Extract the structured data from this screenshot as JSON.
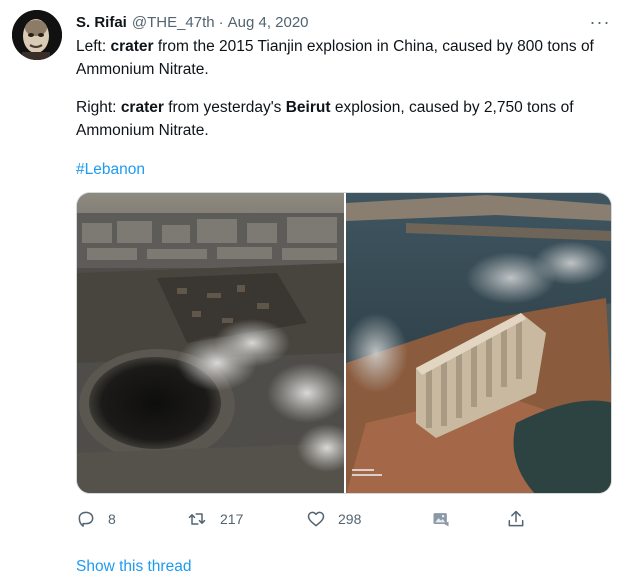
{
  "tweet": {
    "author_name": "S. Rifai",
    "handle": "@THE_47th",
    "separator": "·",
    "date": "Aug 4, 2020",
    "more_label": "···",
    "p1": {
      "prefix": "Left: ",
      "bold1": "crater",
      "middle": " from the 2015 Tianjin explosion in China, caused by 800 tons of Ammonium Nitrate."
    },
    "p2": {
      "prefix": "Right: ",
      "bold1": "crater",
      "middle": " from yesterday's ",
      "bold2": "Beirut",
      "suffix": " explosion, caused by 2,750 tons of Ammonium Nitrate."
    },
    "hashtag": "#Lebanon",
    "actions": {
      "reply_count": "8",
      "retweet_count": "217",
      "like_count": "298"
    },
    "show_thread": "Show this thread"
  },
  "icons": {
    "reply": "reply-icon",
    "retweet": "retweet-icon",
    "like": "heart-icon",
    "share": "share-image-icon",
    "upload": "upload-icon",
    "more": "more-dots-icon"
  },
  "colors": {
    "link": "#1d9bf0",
    "secondary_text": "#536471",
    "text": "#0f1419"
  }
}
